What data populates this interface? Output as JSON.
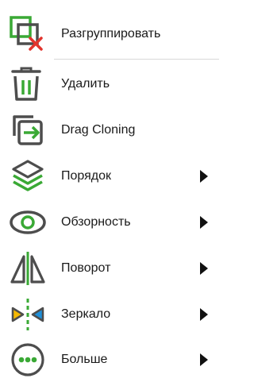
{
  "menu": {
    "items": [
      {
        "label": "Разгруппировать",
        "icon": "ungroup-icon",
        "submenu": false
      },
      {
        "label": "Удалить",
        "icon": "trash-icon",
        "submenu": false
      },
      {
        "label": "Drag Cloning",
        "icon": "drag-clone-icon",
        "submenu": false
      },
      {
        "label": "Порядок",
        "icon": "layers-order-icon",
        "submenu": true
      },
      {
        "label": "Обзорность",
        "icon": "eye-visibility-icon",
        "submenu": true
      },
      {
        "label": "Поворот",
        "icon": "rotate-icon",
        "submenu": true
      },
      {
        "label": "Зеркало",
        "icon": "mirror-icon",
        "submenu": true
      },
      {
        "label": "Больше",
        "icon": "more-icon",
        "submenu": true
      }
    ]
  },
  "colors": {
    "accent_green": "#3aa935",
    "icon_gray": "#4d4d4d",
    "delete_red": "#e2342d",
    "mirror_yellow": "#f5b800",
    "mirror_blue": "#1f8fd8"
  }
}
